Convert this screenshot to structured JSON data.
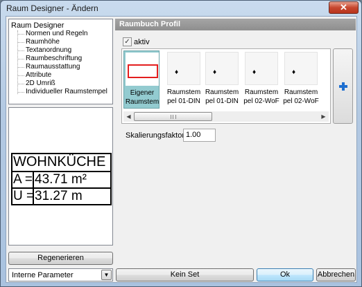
{
  "window": {
    "title": "Raum Designer - Ändern",
    "close_glyph": "✕"
  },
  "tree": {
    "root": "Raum Designer",
    "items": [
      "Normen und Regeln",
      "Raumhöhe",
      "Textanordnung",
      "Raumbeschriftung",
      "Raumausstattung",
      "Attribute",
      "2D Umriß",
      "Individueller Raumstempel"
    ]
  },
  "preview": {
    "name": "WOHNKÜCHE",
    "rows": [
      {
        "key": "A =",
        "value": "43.71 m²"
      },
      {
        "key": "U =",
        "value": "31.27 m"
      }
    ]
  },
  "left_footer": {
    "regen_label": "Regenerieren",
    "params_value": "Interne Parameter"
  },
  "section": {
    "header": "Raumbuch Profil",
    "active_label": "aktiv",
    "active_checked": true
  },
  "gallery": {
    "tiles": [
      {
        "line1": "Eigener",
        "line2": "Raumstem",
        "selected": true
      },
      {
        "line1": "Raumstem",
        "line2": "pel 01-DIN",
        "selected": false
      },
      {
        "line1": "Raumstem",
        "line2": "pel 01-DIN",
        "selected": false
      },
      {
        "line1": "Raumstem",
        "line2": "pel 02-WoF",
        "selected": false
      },
      {
        "line1": "Raumstem",
        "line2": "pel 02-WoF",
        "selected": false
      }
    ]
  },
  "scale": {
    "label": "Skalierungsfaktor :",
    "value": "1.00"
  },
  "footer": {
    "kein_set": "Kein Set",
    "ok": "Ok",
    "cancel": "Abbrechen"
  },
  "icons": {
    "add": "plus-icon",
    "tile_marker": "pin-icon"
  },
  "colors": {
    "accent_plus": "#1e6fd0",
    "selected_tile": "#93cbd0",
    "stamp_frame": "#e31e1e"
  }
}
